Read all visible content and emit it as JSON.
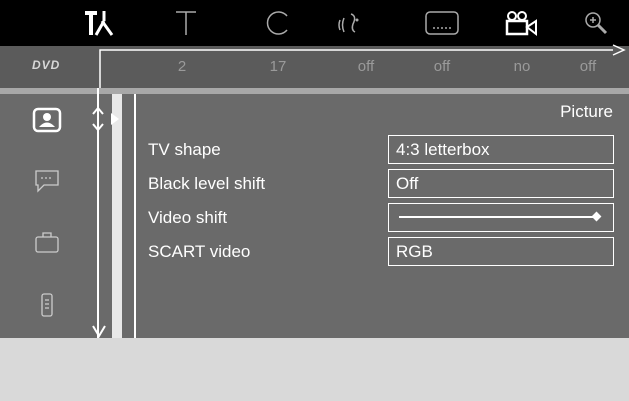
{
  "top_icons": [
    {
      "name": "tools-icon",
      "active": true
    },
    {
      "name": "title-icon"
    },
    {
      "name": "chapter-icon"
    },
    {
      "name": "audio-icon"
    },
    {
      "name": "subtitle-icon"
    },
    {
      "name": "camera-angle-icon"
    },
    {
      "name": "zoom-icon"
    }
  ],
  "status": {
    "disc_logo": "DVD",
    "values": [
      "2",
      "17",
      "off",
      "off",
      "no",
      "off"
    ]
  },
  "sidebar": {
    "items": [
      {
        "name": "picture-icon",
        "selected": true
      },
      {
        "name": "language-icon"
      },
      {
        "name": "features-icon"
      },
      {
        "name": "remote-icon"
      }
    ]
  },
  "panel": {
    "title": "Picture",
    "settings": [
      {
        "label": "TV shape",
        "value": "4:3 letterbox"
      },
      {
        "label": "Black level shift",
        "value": "Off"
      },
      {
        "label": "Video shift",
        "value": "",
        "slider_level": 1.0
      },
      {
        "label": "SCART video",
        "value": "RGB"
      }
    ]
  },
  "colors": {
    "top_bar": "#000000",
    "status_bg": "#5b5b5b",
    "panel_bg": "#6a6a6a",
    "text": "#ffffff",
    "status_text": "#9a9a9a"
  }
}
